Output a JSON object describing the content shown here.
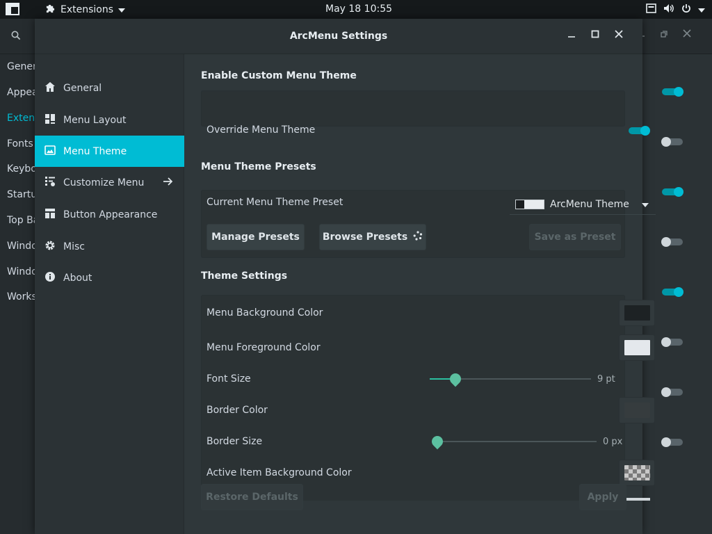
{
  "topbar": {
    "app_label": "Extensions",
    "clock": "May 18  10:55"
  },
  "background_window": {
    "sidebar_items": [
      "General",
      "Appearance",
      "Extensions",
      "Fonts",
      "Keyboard",
      "Startup",
      "Top Bar",
      "Window",
      "Windows",
      "Workspaces"
    ],
    "active_item": "Extensions",
    "toggles": [
      true,
      false,
      true,
      false,
      true,
      false,
      false,
      false
    ]
  },
  "dialog": {
    "title": "ArcMenu Settings",
    "nav": [
      {
        "label": "General",
        "icon": "home-icon"
      },
      {
        "label": "Menu Layout",
        "icon": "layout-icon"
      },
      {
        "label": "Menu Theme",
        "icon": "theme-icon",
        "active": true
      },
      {
        "label": "Customize Menu",
        "icon": "customize-icon",
        "has_arrow": true
      },
      {
        "label": "Button Appearance",
        "icon": "button-appearance-icon"
      },
      {
        "label": "Misc",
        "icon": "gear-icon"
      },
      {
        "label": "About",
        "icon": "info-icon"
      }
    ],
    "enable_section": {
      "title": "Enable Custom Menu Theme",
      "override_label": "Override Menu Theme",
      "override_on": true
    },
    "presets_section": {
      "title": "Menu Theme Presets",
      "current_label": "Current Menu Theme Preset",
      "current_value": "ArcMenu Theme",
      "manage_label": "Manage Presets",
      "browse_label": "Browse Presets",
      "save_label": "Save as Preset"
    },
    "theme_section": {
      "title": "Theme Settings",
      "menu_bg_label": "Menu Background Color",
      "menu_bg_color": "#1d2224",
      "menu_fg_label": "Menu Foreground Color",
      "menu_fg_color": "#e4e8ec",
      "font_size_label": "Font Size",
      "font_size_value": "9 pt",
      "font_size_fraction": 0.16,
      "border_color_label": "Border Color",
      "border_color": "#363c3e",
      "border_size_label": "Border Size",
      "border_size_value": "0 px",
      "border_size_fraction": 0.0,
      "active_item_bg_label": "Active Item Background Color"
    },
    "footer": {
      "restore_label": "Restore Defaults",
      "apply_label": "Apply"
    }
  },
  "colors": {
    "accent": "#00bcd4",
    "toggle_on": "#00bcd4",
    "slider_green": "#5cc0a0"
  }
}
